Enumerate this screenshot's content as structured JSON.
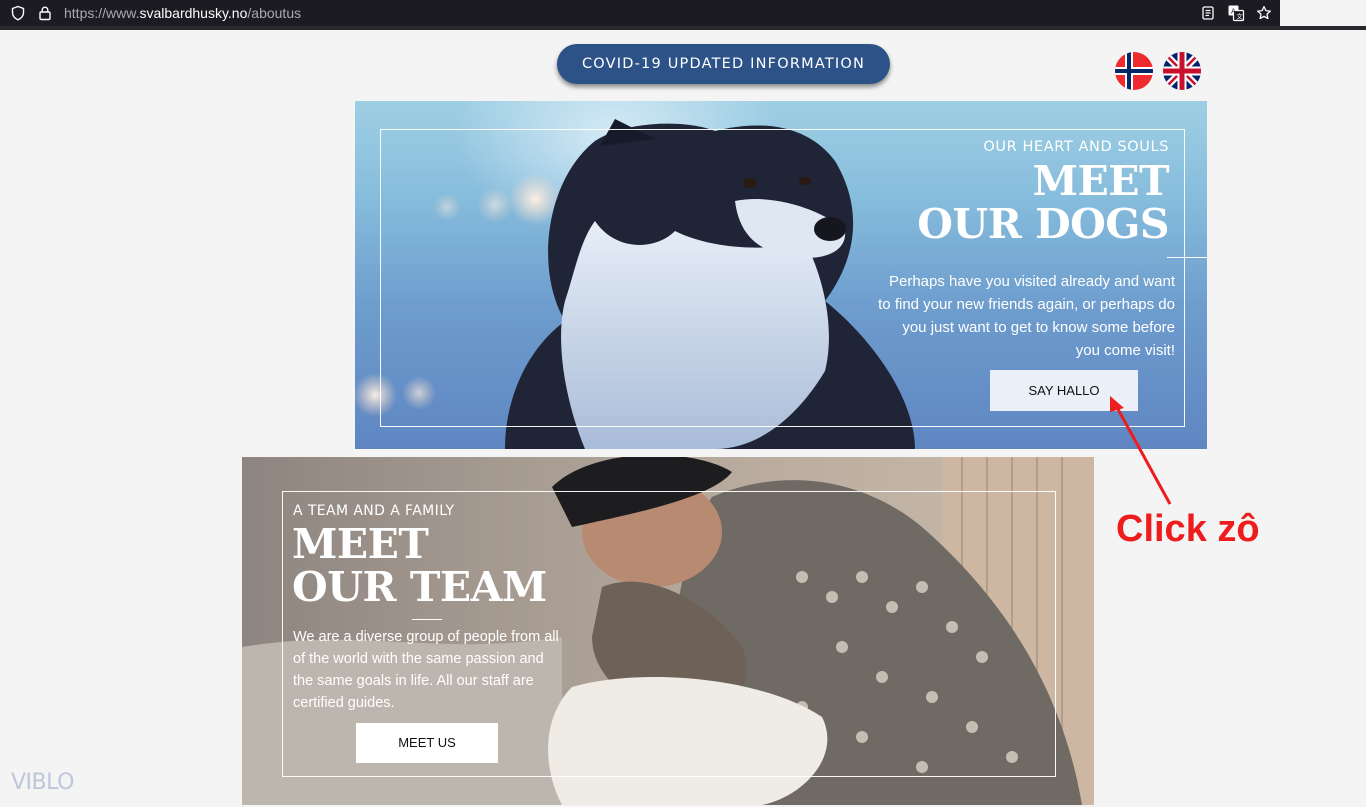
{
  "browser": {
    "url_scheme": "https://www.",
    "url_host": "svalbardhusky.no",
    "url_path": "/aboutus",
    "icons": [
      "shield-icon",
      "lock-icon",
      "reader-view-icon",
      "translate-icon",
      "bookmark-star-icon"
    ]
  },
  "header": {
    "covid_button": "COVID-19 UPDATED INFORMATION",
    "languages": [
      {
        "name": "norwegian-flag"
      },
      {
        "name": "uk-flag"
      }
    ]
  },
  "dogs_section": {
    "kicker": "OUR HEART AND SOULS",
    "title_line1": "MEET",
    "title_line2": "OUR DOGS",
    "description": "Perhaps have you visited already and want to find your new friends again, or perhaps do you just want to get to know some before you come visit!",
    "button": "SAY HALLO"
  },
  "team_section": {
    "kicker": "A TEAM AND A FAMILY",
    "title_line1": "MEET",
    "title_line2": "OUR TEAM",
    "description": "We are a diverse group of people from all of the world with the same passion and the same goals in life. All our staff are certified guides.",
    "button": "MEET US"
  },
  "annotation": {
    "text": "Click zô",
    "color": "#ee1c1c"
  },
  "watermark": {
    "text": "VIBLO"
  },
  "colors": {
    "covid_button_bg": "#2d5288",
    "page_bg": "#f4f4f4",
    "urlbar_bg": "#1c1b22"
  }
}
